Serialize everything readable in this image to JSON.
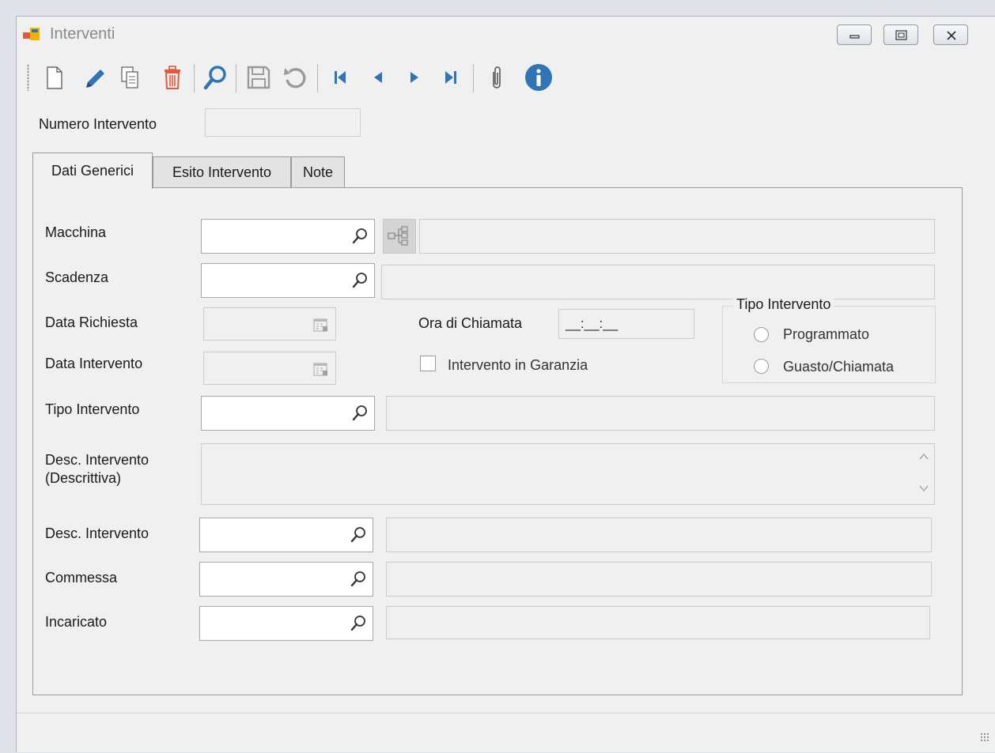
{
  "window": {
    "title": "Interventi"
  },
  "toolbar": {
    "buttons": [
      "new-icon",
      "edit-icon",
      "copy-icon",
      "delete-icon",
      "search-icon",
      "save-icon",
      "undo-icon",
      "first-record-icon",
      "previous-record-icon",
      "next-record-icon",
      "last-record-icon",
      "attachment-icon",
      "info-icon"
    ],
    "colors": {
      "edit": "#2e75b6",
      "delete": "#e2593e",
      "nav": "#2e75b6",
      "disabled": "#9a9a9a"
    }
  },
  "header": {
    "numero_label": "Numero Intervento",
    "numero_value": ""
  },
  "tabs": [
    {
      "label": "Dati Generici"
    },
    {
      "label": "Esito Intervento"
    },
    {
      "label": "Note"
    }
  ],
  "form": {
    "macchina": {
      "label": "Macchina",
      "code": "",
      "desc": ""
    },
    "scadenza": {
      "label": "Scadenza",
      "code": "",
      "desc": ""
    },
    "data_richiesta": {
      "label": "Data Richiesta",
      "value": ""
    },
    "data_intervento": {
      "label": "Data Intervento",
      "value": ""
    },
    "ora_chiamata": {
      "label": "Ora di Chiamata",
      "value": "__:__:__"
    },
    "garanzia": {
      "label": "Intervento in Garanzia",
      "checked": false
    },
    "tipo_group": {
      "title": "Tipo Intervento",
      "options": [
        "Programmato",
        "Guasto/Chiamata"
      ]
    },
    "tipo_intervento": {
      "label": "Tipo Intervento",
      "code": "",
      "desc": ""
    },
    "desc_descrittiva": {
      "label_line1": "Desc. Intervento",
      "label_line2": "(Descrittiva)",
      "value": ""
    },
    "desc_intervento": {
      "label": "Desc. Intervento",
      "code": "",
      "desc": ""
    },
    "commessa": {
      "label": "Commessa",
      "code": "",
      "desc": ""
    },
    "incaricato": {
      "label": "Incaricato",
      "code": "",
      "desc": ""
    }
  }
}
